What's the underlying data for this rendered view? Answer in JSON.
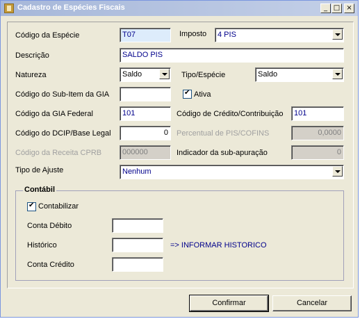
{
  "window": {
    "title": "Cadastro de Espécies Fiscais",
    "controls": [
      "_",
      "□",
      "×"
    ]
  },
  "form": {
    "codigo_especie_label": "Código da Espécie",
    "codigo_especie_value": "T07",
    "imposto_label": "Imposto",
    "imposto_value": "4 PIS",
    "descricao_label": "Descrição",
    "descricao_value": "SALDO PIS",
    "natureza_label": "Natureza",
    "natureza_value": "Saldo",
    "tipo_especie_label": "Tipo/Espécie",
    "tipo_especie_value": "Saldo",
    "subitem_gia_label": "Código do Sub-Item da GIA",
    "subitem_gia_value": "",
    "ativa_label": "Ativa",
    "gia_federal_label": "Código da GIA Federal",
    "gia_federal_value": "101",
    "credito_contrib_label": "Código de Crédito/Contribuição",
    "credito_contrib_value": "101",
    "dcip_label": "Código do DCIP/Base Legal",
    "dcip_value": "0",
    "percentual_label": "Percentual de PIS/COFINS",
    "percentual_value": "0,0000",
    "receita_cprb_label": "Código da Receita CPRB",
    "receita_cprb_value": "000000",
    "indicador_label": "Indicador da sub-apuração",
    "indicador_value": "0",
    "tipo_ajuste_label": "Tipo de Ajuste",
    "tipo_ajuste_value": "Nenhum"
  },
  "contabil": {
    "title": "Contábil",
    "contabilizar_label": "Contabilizar",
    "conta_debito_label": "Conta Débito",
    "conta_debito_value": "",
    "historico_label": "Histórico",
    "historico_value": "",
    "historico_hint": "=> INFORMAR HISTORICO",
    "conta_credito_label": "Conta Crédito",
    "conta_credito_value": ""
  },
  "buttons": {
    "confirmar": "Confirmar",
    "cancelar": "Cancelar"
  }
}
